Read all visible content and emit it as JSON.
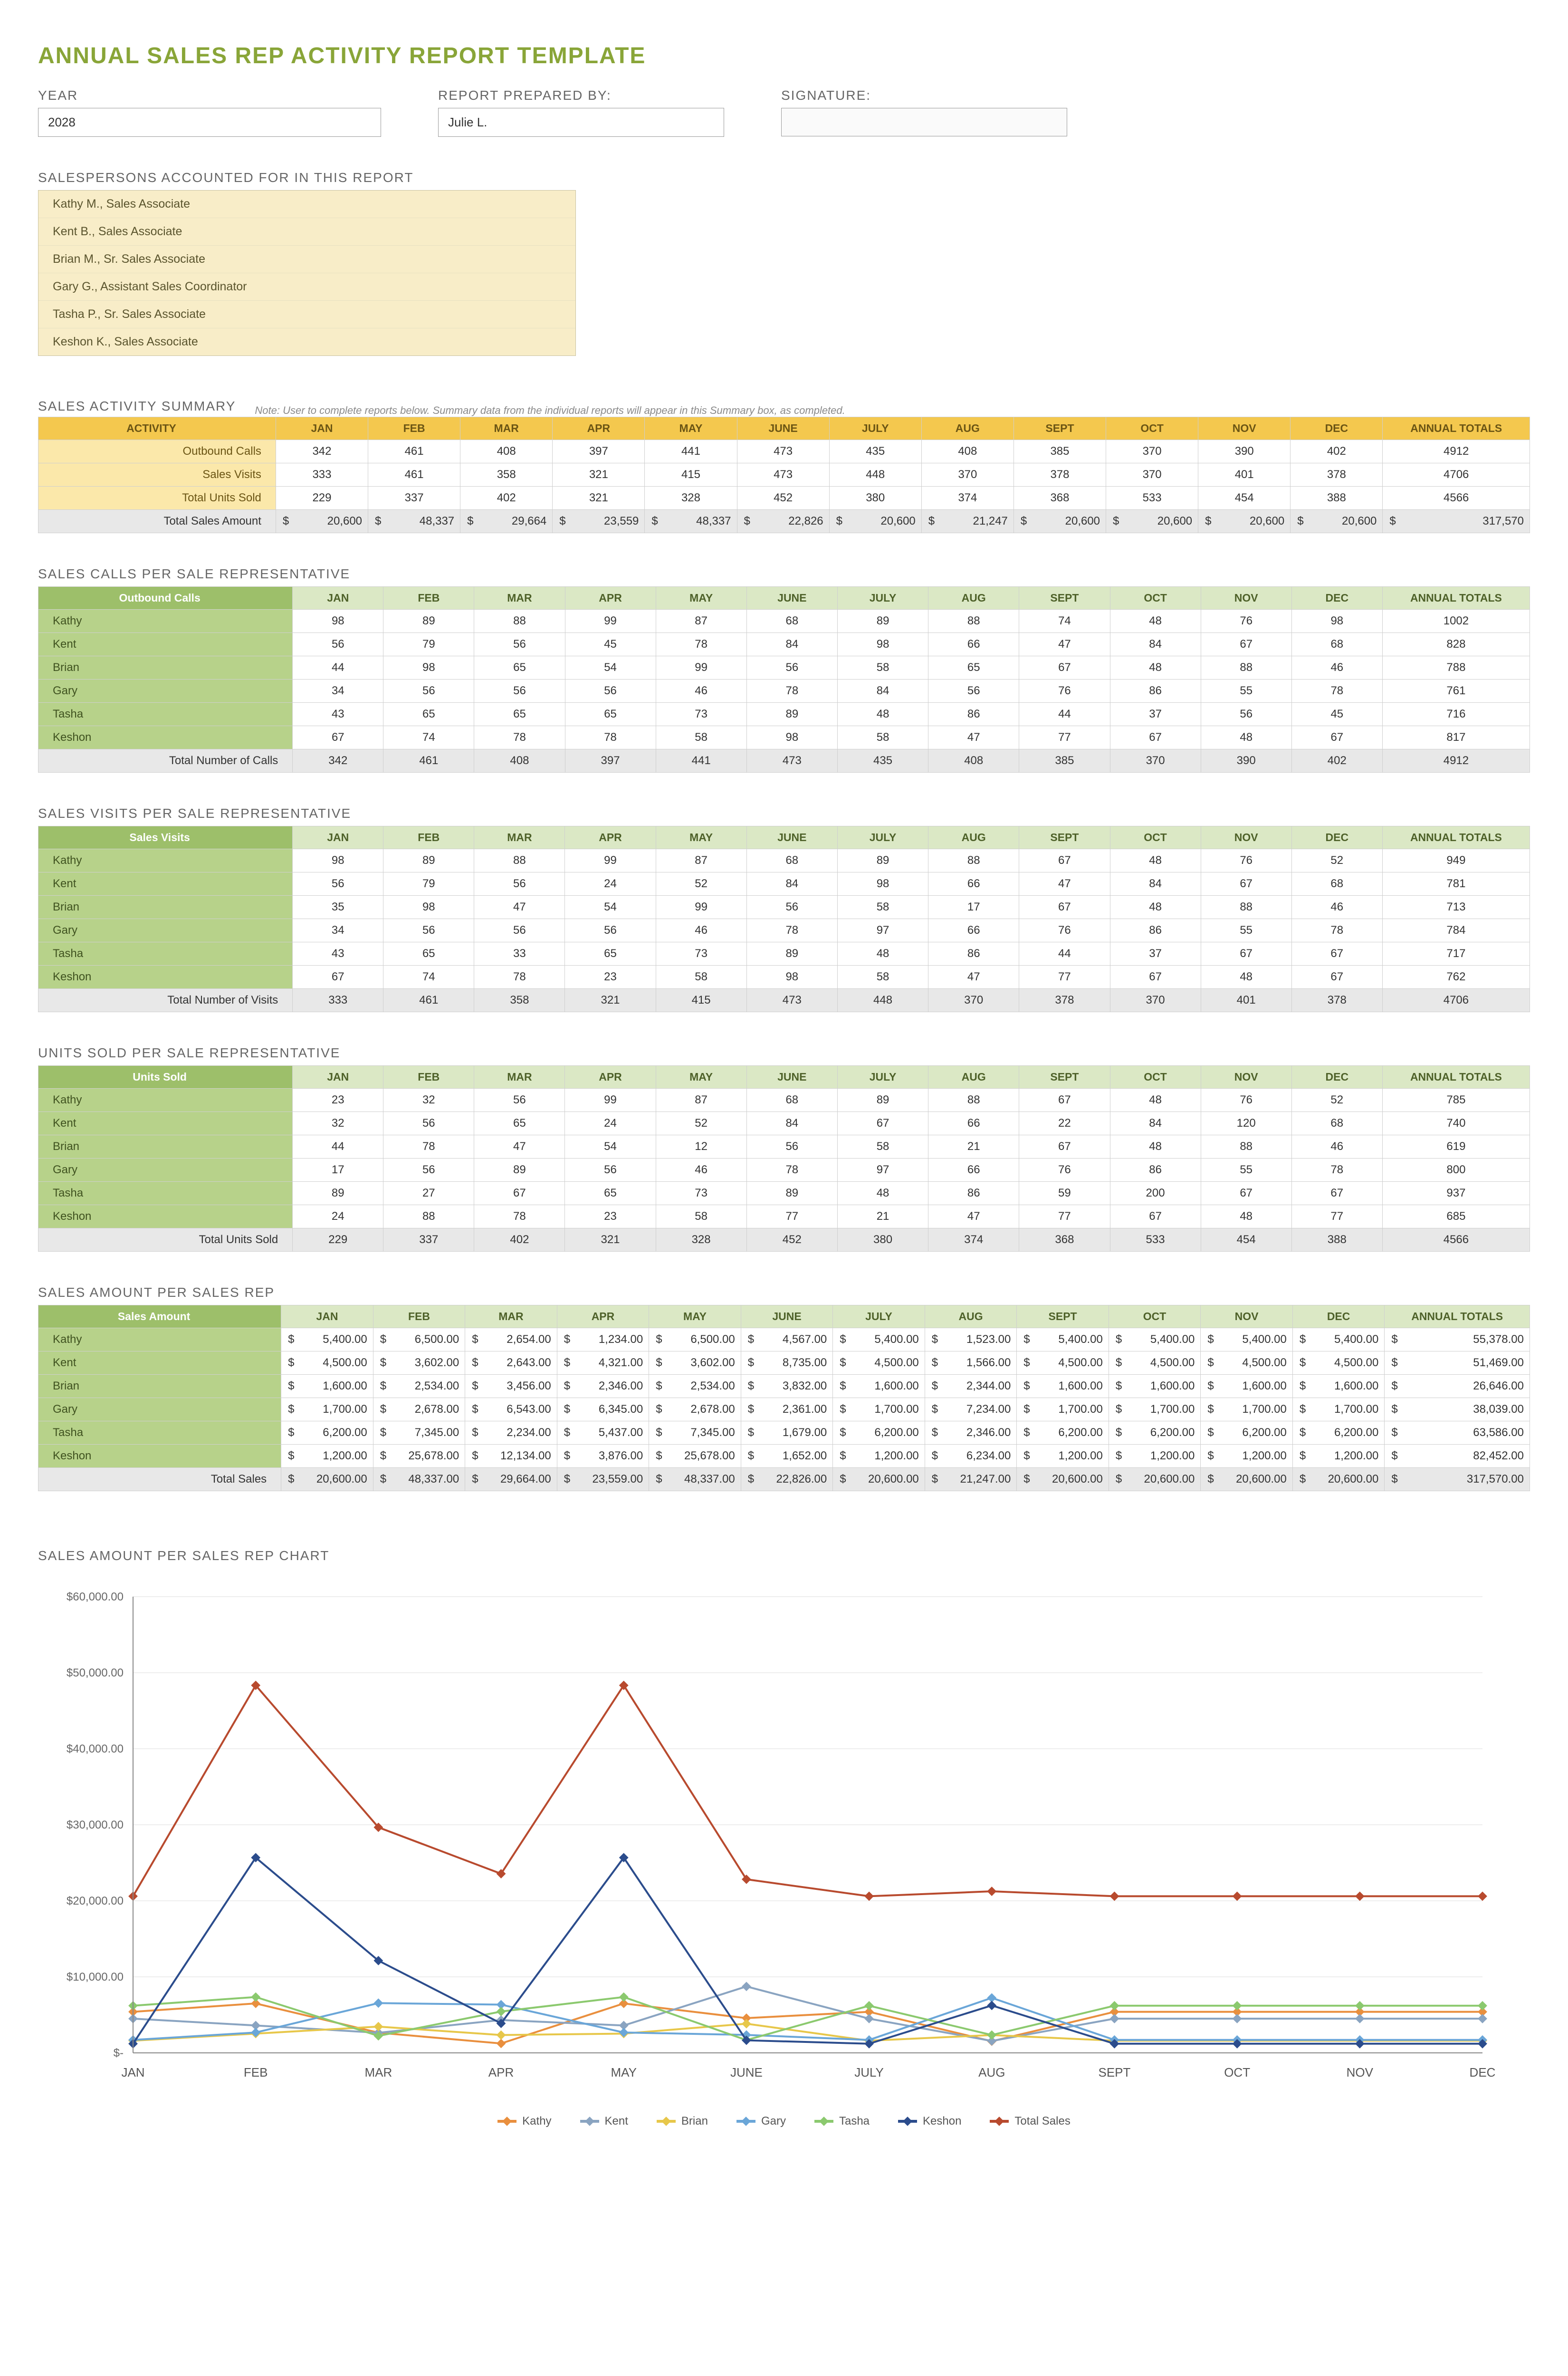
{
  "title": "ANNUAL SALES REP ACTIVITY REPORT TEMPLATE",
  "header": {
    "year_label": "YEAR",
    "year_value": "2028",
    "prepared_label": "REPORT PREPARED BY:",
    "prepared_value": "Julie L.",
    "signature_label": "SIGNATURE:",
    "signature_value": ""
  },
  "salespersons": {
    "label": "SALESPERSONS ACCOUNTED FOR IN THIS REPORT",
    "list": [
      "Kathy M., Sales Associate",
      "Kent B., Sales Associate",
      "Brian M., Sr. Sales Associate",
      "Gary G., Assistant Sales Coordinator",
      "Tasha P., Sr. Sales Associate",
      "Keshon K., Sales Associate"
    ]
  },
  "months": [
    "JAN",
    "FEB",
    "MAR",
    "APR",
    "MAY",
    "JUNE",
    "JULY",
    "AUG",
    "SEPT",
    "OCT",
    "NOV",
    "DEC"
  ],
  "annual_totals_label": "ANNUAL TOTALS",
  "summary": {
    "title": "SALES ACTIVITY SUMMARY",
    "note": "Note: User to complete reports below. Summary data from the individual reports will appear in this Summary box, as completed.",
    "activity_label": "ACTIVITY",
    "rows": [
      {
        "label": "Outbound Calls",
        "vals": [
          342,
          461,
          408,
          397,
          441,
          473,
          435,
          408,
          385,
          370,
          390,
          402
        ],
        "total": 4912
      },
      {
        "label": "Sales Visits",
        "vals": [
          333,
          461,
          358,
          321,
          415,
          473,
          448,
          370,
          378,
          370,
          401,
          378
        ],
        "total": 4706
      },
      {
        "label": "Total Units Sold",
        "vals": [
          229,
          337,
          402,
          321,
          328,
          452,
          380,
          374,
          368,
          533,
          454,
          388
        ],
        "total": 4566
      }
    ],
    "amount_row": {
      "label": "Total Sales Amount",
      "vals": [
        "20,600",
        "48,337",
        "29,664",
        "23,559",
        "48,337",
        "22,826",
        "20,600",
        "21,247",
        "20,600",
        "20,600",
        "20,600",
        "20,600"
      ],
      "total": "317,570"
    }
  },
  "calls": {
    "title": "SALES CALLS PER SALE REPRESENTATIVE",
    "header_label": "Outbound Calls",
    "rows": [
      {
        "label": "Kathy",
        "vals": [
          98,
          89,
          88,
          99,
          87,
          68,
          89,
          88,
          74,
          48,
          76,
          98
        ],
        "total": 1002
      },
      {
        "label": "Kent",
        "vals": [
          56,
          79,
          56,
          45,
          78,
          84,
          98,
          66,
          47,
          84,
          67,
          68
        ],
        "total": 828
      },
      {
        "label": "Brian",
        "vals": [
          44,
          98,
          65,
          54,
          99,
          56,
          58,
          65,
          67,
          48,
          88,
          46
        ],
        "total": 788
      },
      {
        "label": "Gary",
        "vals": [
          34,
          56,
          56,
          56,
          46,
          78,
          84,
          56,
          76,
          86,
          55,
          78
        ],
        "total": 761
      },
      {
        "label": "Tasha",
        "vals": [
          43,
          65,
          65,
          65,
          73,
          89,
          48,
          86,
          44,
          37,
          56,
          45
        ],
        "total": 716
      },
      {
        "label": "Keshon",
        "vals": [
          67,
          74,
          78,
          78,
          58,
          98,
          58,
          47,
          77,
          67,
          48,
          67
        ],
        "total": 817
      }
    ],
    "total_row": {
      "label": "Total Number of Calls",
      "vals": [
        342,
        461,
        408,
        397,
        441,
        473,
        435,
        408,
        385,
        370,
        390,
        402
      ],
      "total": 4912
    }
  },
  "visits": {
    "title": "SALES VISITS PER SALE REPRESENTATIVE",
    "header_label": "Sales Visits",
    "rows": [
      {
        "label": "Kathy",
        "vals": [
          98,
          89,
          88,
          99,
          87,
          68,
          89,
          88,
          67,
          48,
          76,
          52
        ],
        "total": 949
      },
      {
        "label": "Kent",
        "vals": [
          56,
          79,
          56,
          24,
          52,
          84,
          98,
          66,
          47,
          84,
          67,
          68
        ],
        "total": 781
      },
      {
        "label": "Brian",
        "vals": [
          35,
          98,
          47,
          54,
          99,
          56,
          58,
          17,
          67,
          48,
          88,
          46
        ],
        "total": 713
      },
      {
        "label": "Gary",
        "vals": [
          34,
          56,
          56,
          56,
          46,
          78,
          97,
          66,
          76,
          86,
          55,
          78
        ],
        "total": 784
      },
      {
        "label": "Tasha",
        "vals": [
          43,
          65,
          33,
          65,
          73,
          89,
          48,
          86,
          44,
          37,
          67,
          67
        ],
        "total": 717
      },
      {
        "label": "Keshon",
        "vals": [
          67,
          74,
          78,
          23,
          58,
          98,
          58,
          47,
          77,
          67,
          48,
          67
        ],
        "total": 762
      }
    ],
    "total_row": {
      "label": "Total Number of Visits",
      "vals": [
        333,
        461,
        358,
        321,
        415,
        473,
        448,
        370,
        378,
        370,
        401,
        378
      ],
      "total": 4706
    }
  },
  "units": {
    "title": "UNITS SOLD PER SALE REPRESENTATIVE",
    "header_label": "Units Sold",
    "rows": [
      {
        "label": "Kathy",
        "vals": [
          23,
          32,
          56,
          99,
          87,
          68,
          89,
          88,
          67,
          48,
          76,
          52
        ],
        "total": 785
      },
      {
        "label": "Kent",
        "vals": [
          32,
          56,
          65,
          24,
          52,
          84,
          67,
          66,
          22,
          84,
          120,
          68
        ],
        "total": 740
      },
      {
        "label": "Brian",
        "vals": [
          44,
          78,
          47,
          54,
          12,
          56,
          58,
          21,
          67,
          48,
          88,
          46
        ],
        "total": 619
      },
      {
        "label": "Gary",
        "vals": [
          17,
          56,
          89,
          56,
          46,
          78,
          97,
          66,
          76,
          86,
          55,
          78
        ],
        "total": 800
      },
      {
        "label": "Tasha",
        "vals": [
          89,
          27,
          67,
          65,
          73,
          89,
          48,
          86,
          59,
          200,
          67,
          67
        ],
        "total": 937
      },
      {
        "label": "Keshon",
        "vals": [
          24,
          88,
          78,
          23,
          58,
          77,
          21,
          47,
          77,
          67,
          48,
          77
        ],
        "total": 685
      }
    ],
    "total_row": {
      "label": "Total Units Sold",
      "vals": [
        229,
        337,
        402,
        321,
        328,
        452,
        380,
        374,
        368,
        533,
        454,
        388
      ],
      "total": 4566
    }
  },
  "amount": {
    "title": "SALES AMOUNT PER SALES REP",
    "header_label": "Sales Amount",
    "rows": [
      {
        "label": "Kathy",
        "vals": [
          "5,400.00",
          "6,500.00",
          "2,654.00",
          "1,234.00",
          "6,500.00",
          "4,567.00",
          "5,400.00",
          "1,523.00",
          "5,400.00",
          "5,400.00",
          "5,400.00",
          "5,400.00"
        ],
        "total": "55,378.00"
      },
      {
        "label": "Kent",
        "vals": [
          "4,500.00",
          "3,602.00",
          "2,643.00",
          "4,321.00",
          "3,602.00",
          "8,735.00",
          "4,500.00",
          "1,566.00",
          "4,500.00",
          "4,500.00",
          "4,500.00",
          "4,500.00"
        ],
        "total": "51,469.00"
      },
      {
        "label": "Brian",
        "vals": [
          "1,600.00",
          "2,534.00",
          "3,456.00",
          "2,346.00",
          "2,534.00",
          "3,832.00",
          "1,600.00",
          "2,344.00",
          "1,600.00",
          "1,600.00",
          "1,600.00",
          "1,600.00"
        ],
        "total": "26,646.00"
      },
      {
        "label": "Gary",
        "vals": [
          "1,700.00",
          "2,678.00",
          "6,543.00",
          "6,345.00",
          "2,678.00",
          "2,361.00",
          "1,700.00",
          "7,234.00",
          "1,700.00",
          "1,700.00",
          "1,700.00",
          "1,700.00"
        ],
        "total": "38,039.00"
      },
      {
        "label": "Tasha",
        "vals": [
          "6,200.00",
          "7,345.00",
          "2,234.00",
          "5,437.00",
          "7,345.00",
          "1,679.00",
          "6,200.00",
          "2,346.00",
          "6,200.00",
          "6,200.00",
          "6,200.00",
          "6,200.00"
        ],
        "total": "63,586.00"
      },
      {
        "label": "Keshon",
        "vals": [
          "1,200.00",
          "25,678.00",
          "12,134.00",
          "3,876.00",
          "25,678.00",
          "1,652.00",
          "1,200.00",
          "6,234.00",
          "1,200.00",
          "1,200.00",
          "1,200.00",
          "1,200.00"
        ],
        "total": "82,452.00"
      }
    ],
    "total_row": {
      "label": "Total Sales",
      "vals": [
        "20,600.00",
        "48,337.00",
        "29,664.00",
        "23,559.00",
        "48,337.00",
        "22,826.00",
        "20,600.00",
        "21,247.00",
        "20,600.00",
        "20,600.00",
        "20,600.00",
        "20,600.00"
      ],
      "total": "317,570.00"
    }
  },
  "chart_data": {
    "type": "line",
    "title": "SALES AMOUNT PER SALES REP CHART",
    "categories": [
      "JAN",
      "FEB",
      "MAR",
      "APR",
      "MAY",
      "JUNE",
      "JULY",
      "AUG",
      "SEPT",
      "OCT",
      "NOV",
      "DEC"
    ],
    "ylim": [
      0,
      60000
    ],
    "ylabel_format": "currency",
    "yticks": [
      "$-",
      "$10,000.00",
      "$20,000.00",
      "$30,000.00",
      "$40,000.00",
      "$50,000.00",
      "$60,000.00"
    ],
    "series": [
      {
        "name": "Kathy",
        "color": "#e98f3e",
        "values": [
          5400,
          6500,
          2654,
          1234,
          6500,
          4567,
          5400,
          1523,
          5400,
          5400,
          5400,
          5400
        ]
      },
      {
        "name": "Kent",
        "color": "#8aa4c1",
        "values": [
          4500,
          3602,
          2643,
          4321,
          3602,
          8735,
          4500,
          1566,
          4500,
          4500,
          4500,
          4500
        ]
      },
      {
        "name": "Brian",
        "color": "#e7c74a",
        "values": [
          1600,
          2534,
          3456,
          2346,
          2534,
          3832,
          1600,
          2344,
          1600,
          1600,
          1600,
          1600
        ]
      },
      {
        "name": "Gary",
        "color": "#6aa6d8",
        "values": [
          1700,
          2678,
          6543,
          6345,
          2678,
          2361,
          1700,
          7234,
          1700,
          1700,
          1700,
          1700
        ]
      },
      {
        "name": "Tasha",
        "color": "#8bc96e",
        "values": [
          6200,
          7345,
          2234,
          5437,
          7345,
          1679,
          6200,
          2346,
          6200,
          6200,
          6200,
          6200
        ]
      },
      {
        "name": "Keshon",
        "color": "#2b4c8c",
        "values": [
          1200,
          25678,
          12134,
          3876,
          25678,
          1652,
          1200,
          6234,
          1200,
          1200,
          1200,
          1200
        ]
      },
      {
        "name": "Total Sales",
        "color": "#b84a2e",
        "values": [
          20600,
          48337,
          29664,
          23559,
          48337,
          22826,
          20600,
          21247,
          20600,
          20600,
          20600,
          20600
        ]
      }
    ]
  }
}
